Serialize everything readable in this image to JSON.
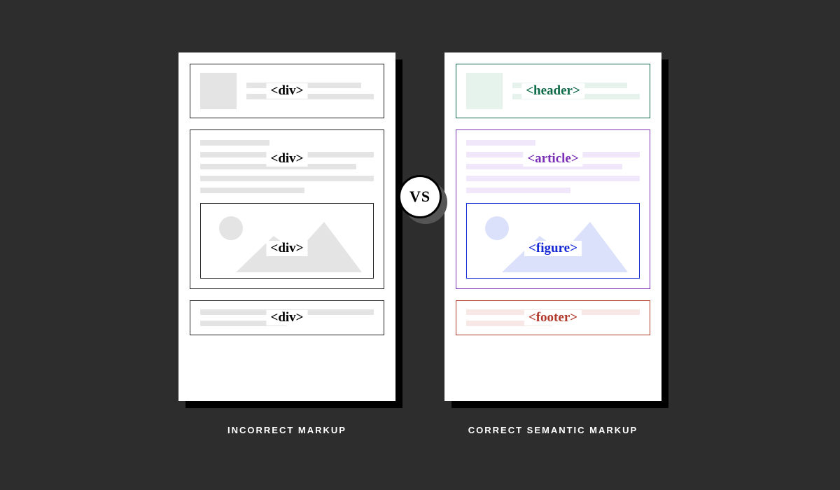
{
  "vs_label": "VS",
  "left": {
    "caption": "INCORRECT MARKUP",
    "header_tag": "<div>",
    "article_tag": "<div>",
    "figure_tag": "<div>",
    "footer_tag": "<div>"
  },
  "right": {
    "caption": "CORRECT SEMANTIC MARKUP",
    "header_tag": "<header>",
    "article_tag": "<article>",
    "figure_tag": "<figure>",
    "footer_tag": "<footer>"
  }
}
